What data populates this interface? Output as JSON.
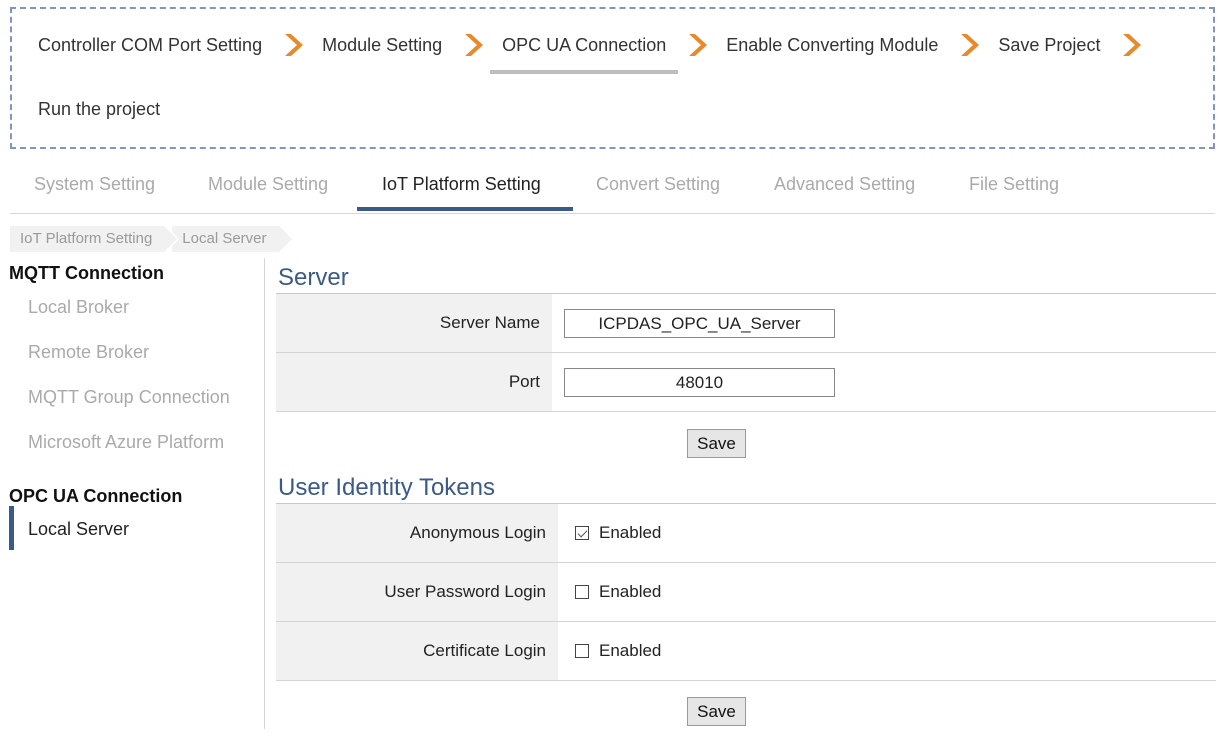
{
  "workflow": {
    "steps": [
      "Controller COM Port Setting",
      "Module Setting",
      "OPC UA Connection",
      "Enable Converting Module",
      "Save Project",
      "Run the project"
    ],
    "active_step": "OPC UA Connection",
    "arrow_color": "#e8892b"
  },
  "tabs": [
    "System Setting",
    "Module Setting",
    "IoT Platform Setting",
    "Convert Setting",
    "Advanced Setting",
    "File Setting"
  ],
  "active_tab": "IoT Platform Setting",
  "breadcrumb": [
    "IoT Platform Setting",
    "Local Server"
  ],
  "sidebar": {
    "mqtt_heading": "MQTT Connection",
    "mqtt_items": [
      "Local Broker",
      "Remote Broker",
      "MQTT Group Connection",
      "Microsoft Azure Platform"
    ],
    "opcua_heading": "OPC UA Connection",
    "opcua_items": [
      "Local Server"
    ],
    "active_item": "Local Server"
  },
  "server": {
    "title": "Server",
    "server_name_label": "Server Name",
    "server_name_value": "ICPDAS_OPC_UA_Server",
    "port_label": "Port",
    "port_value": "48010",
    "save_label": "Save"
  },
  "tokens": {
    "title": "User Identity Tokens",
    "anonymous_label": "Anonymous Login",
    "anonymous_enabled": true,
    "user_password_label": "User Password Login",
    "user_password_enabled": false,
    "certificate_label": "Certificate Login",
    "certificate_enabled": false,
    "enabled_text": "Enabled",
    "save_label": "Save"
  },
  "colors": {
    "accent": "#3b5a8a",
    "banner_border": "#7f95c8",
    "inactive_text": "#aaaaaa"
  }
}
